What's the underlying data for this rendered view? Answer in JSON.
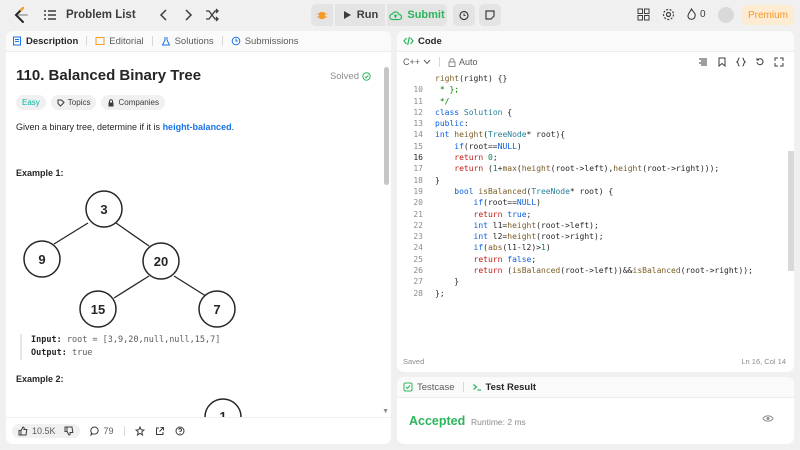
{
  "topbar": {
    "problem_list": "Problem List",
    "run": "Run",
    "submit": "Submit",
    "streak_count": "0",
    "premium": "Premium"
  },
  "left_tabs": [
    {
      "label": "Description",
      "icon": "description-icon"
    },
    {
      "label": "Editorial",
      "icon": "editorial-icon"
    },
    {
      "label": "Solutions",
      "icon": "flask-icon"
    },
    {
      "label": "Submissions",
      "icon": "history-icon"
    }
  ],
  "problem": {
    "title": "110. Balanced Binary Tree",
    "status": "Solved",
    "difficulty": "Easy",
    "chip_topics": "Topics",
    "chip_companies": "Companies",
    "desc_prefix": "Given a binary tree, determine if it is ",
    "desc_highlight": "height-balanced",
    "desc_suffix": ".",
    "example1": "Example 1:",
    "tree_nodes": [
      "3",
      "9",
      "20",
      "15",
      "7"
    ],
    "input_label": "Input:",
    "input_value": "root = [3,9,20,null,null,15,7]",
    "output_label": "Output:",
    "output_value": "true",
    "example2": "Example 2:",
    "example2_node": "1"
  },
  "footer": {
    "likes": "10.5K",
    "comments": "79"
  },
  "code_panel": {
    "tab": "Code",
    "language": "C++",
    "mode": "Auto",
    "saved": "Saved",
    "cursor": "Ln 16, Col 14"
  },
  "test_panel": {
    "tab_testcase": "Testcase",
    "tab_result": "Test Result",
    "verdict": "Accepted",
    "runtime": "Runtime: 2 ms"
  },
  "colors": {
    "accent_green": "#2db55d",
    "easy_teal": "#00b8a3",
    "premium_orange": "#f49a2b",
    "link_blue": "#1a73e8"
  }
}
